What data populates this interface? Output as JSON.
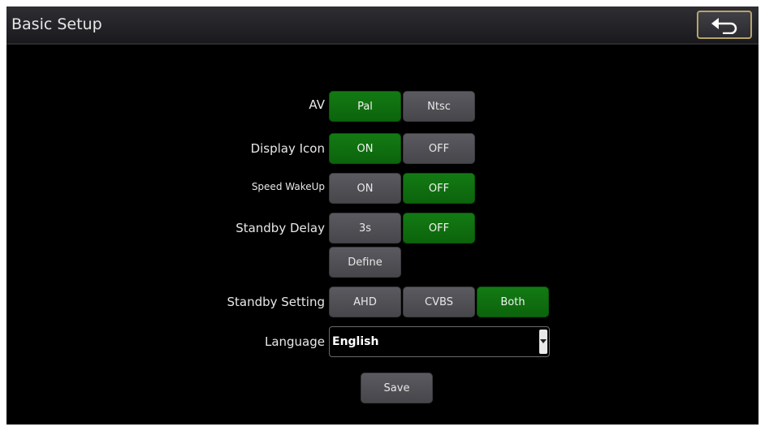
{
  "header": {
    "title": "Basic Setup",
    "back_icon": "back-arrow-icon"
  },
  "settings": {
    "av": {
      "label": "AV",
      "options": [
        "Pal",
        "Ntsc"
      ],
      "selected": "Pal"
    },
    "display_icon": {
      "label": "Display Icon",
      "options": [
        "ON",
        "OFF"
      ],
      "selected": "ON"
    },
    "speed_wakeup": {
      "label": "Speed WakeUp",
      "options": [
        "ON",
        "OFF"
      ],
      "selected": "OFF"
    },
    "standby_delay": {
      "label": "Standby Delay",
      "options": [
        "3s",
        "OFF",
        "Define"
      ],
      "selected": "OFF"
    },
    "standby_setting": {
      "label": "Standby Setting",
      "options": [
        "AHD",
        "CVBS",
        "Both"
      ],
      "selected": "Both"
    },
    "language": {
      "label": "Language",
      "value": "English",
      "arrow_icon": "dropdown-arrow-icon"
    }
  },
  "footer": {
    "save_label": "Save"
  },
  "colors": {
    "selected": "#0f700f",
    "unselected": "#505055",
    "background": "#000000",
    "header": "#2a2a2e",
    "back_border": "#b9a36b"
  }
}
